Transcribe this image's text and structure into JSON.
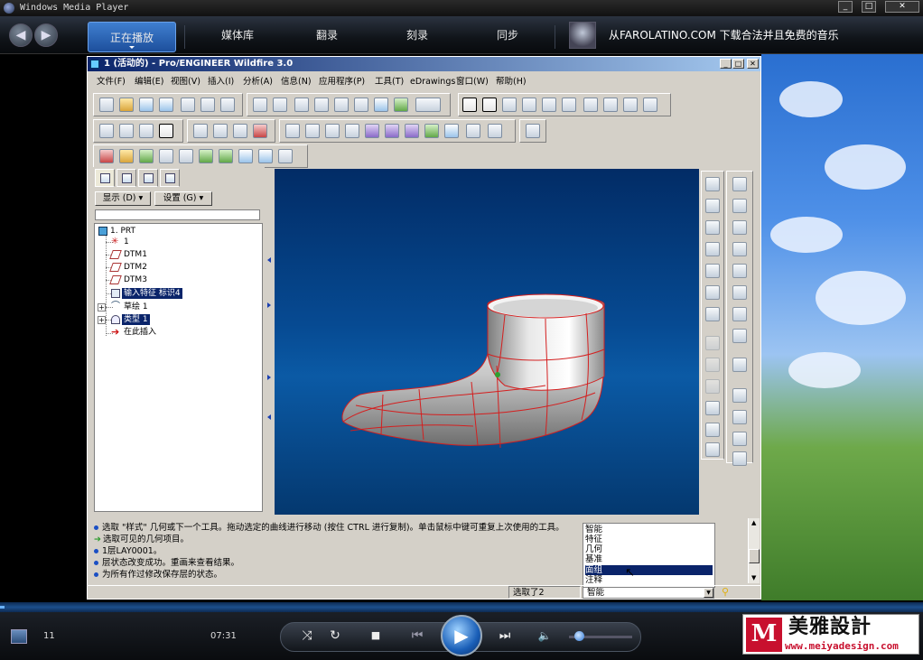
{
  "wmp": {
    "title": "Windows Media Player",
    "win_buttons": [
      "_",
      "□",
      "✕"
    ],
    "nav_back": "◀",
    "nav_forward": "▶",
    "tabs": [
      "正在播放",
      "媒体库",
      "翻录",
      "刻录",
      "同步"
    ],
    "promo_text": "从FAROLATINO.COM 下载合法并且免费的音乐",
    "track_number": "11",
    "elapsed_time": "07:31",
    "seek_progress": 0.005,
    "volume_level": 0.1,
    "watermark_name": "美雅設計",
    "watermark_url": "www.meiyadesign.com",
    "watermark_letter": "M"
  },
  "proe": {
    "title": "1 (活动的) - Pro/ENGINEER Wildfire 3.0",
    "win_buttons": [
      "_",
      "□",
      "✕"
    ],
    "menu": [
      "文件(F)",
      "编辑(E)",
      "视图(V)",
      "插入(I)",
      "分析(A)",
      "信息(N)",
      "应用程序(P)",
      "工具(T)",
      "eDrawings",
      "窗口(W)",
      "帮助(H)"
    ],
    "tree_buttons": {
      "show": "显示 (D) ▾",
      "settings": "设置 (G) ▾"
    },
    "tree": [
      {
        "label": "1. PRT",
        "level": 0
      },
      {
        "label": "1",
        "level": 1
      },
      {
        "label": "DTM1",
        "level": 1
      },
      {
        "label": "DTM2",
        "level": 1
      },
      {
        "label": "DTM3",
        "level": 1
      },
      {
        "label": "输入特征 标识4",
        "level": 1,
        "selected": true
      },
      {
        "label": "草绘 1",
        "level": 1
      },
      {
        "label": "类型 1",
        "level": 1,
        "selected": true
      },
      {
        "label": "在此插入",
        "level": 1
      }
    ],
    "messages": [
      {
        "mark": "bullet",
        "text": "选取 \"样式\" 几何或下一个工具。拖动选定的曲线进行移动 (按住 CTRL 进行复制)。单击鼠标中键可重复上次使用的工具。"
      },
      {
        "mark": "arrow",
        "text": "选取可见的几何项目。"
      },
      {
        "mark": "bullet",
        "text": "1层LAY0001。"
      },
      {
        "mark": "bullet",
        "text": "层状态改变成功。重画来查看结果。"
      },
      {
        "mark": "bullet",
        "text": "为所有作过修改保存层的状态。"
      }
    ],
    "filter_options": [
      "智能",
      "特征",
      "几何",
      "基准",
      "面组",
      "注释"
    ],
    "filter_selected_index": 4,
    "selected_count": "选取了2",
    "filter_value": "智能"
  },
  "colors": {
    "wmp_accent": "#1d4f9c",
    "proe_title": "#0a246a",
    "model_edge": "#d41f1f",
    "gfx_bg": "#064a92"
  }
}
